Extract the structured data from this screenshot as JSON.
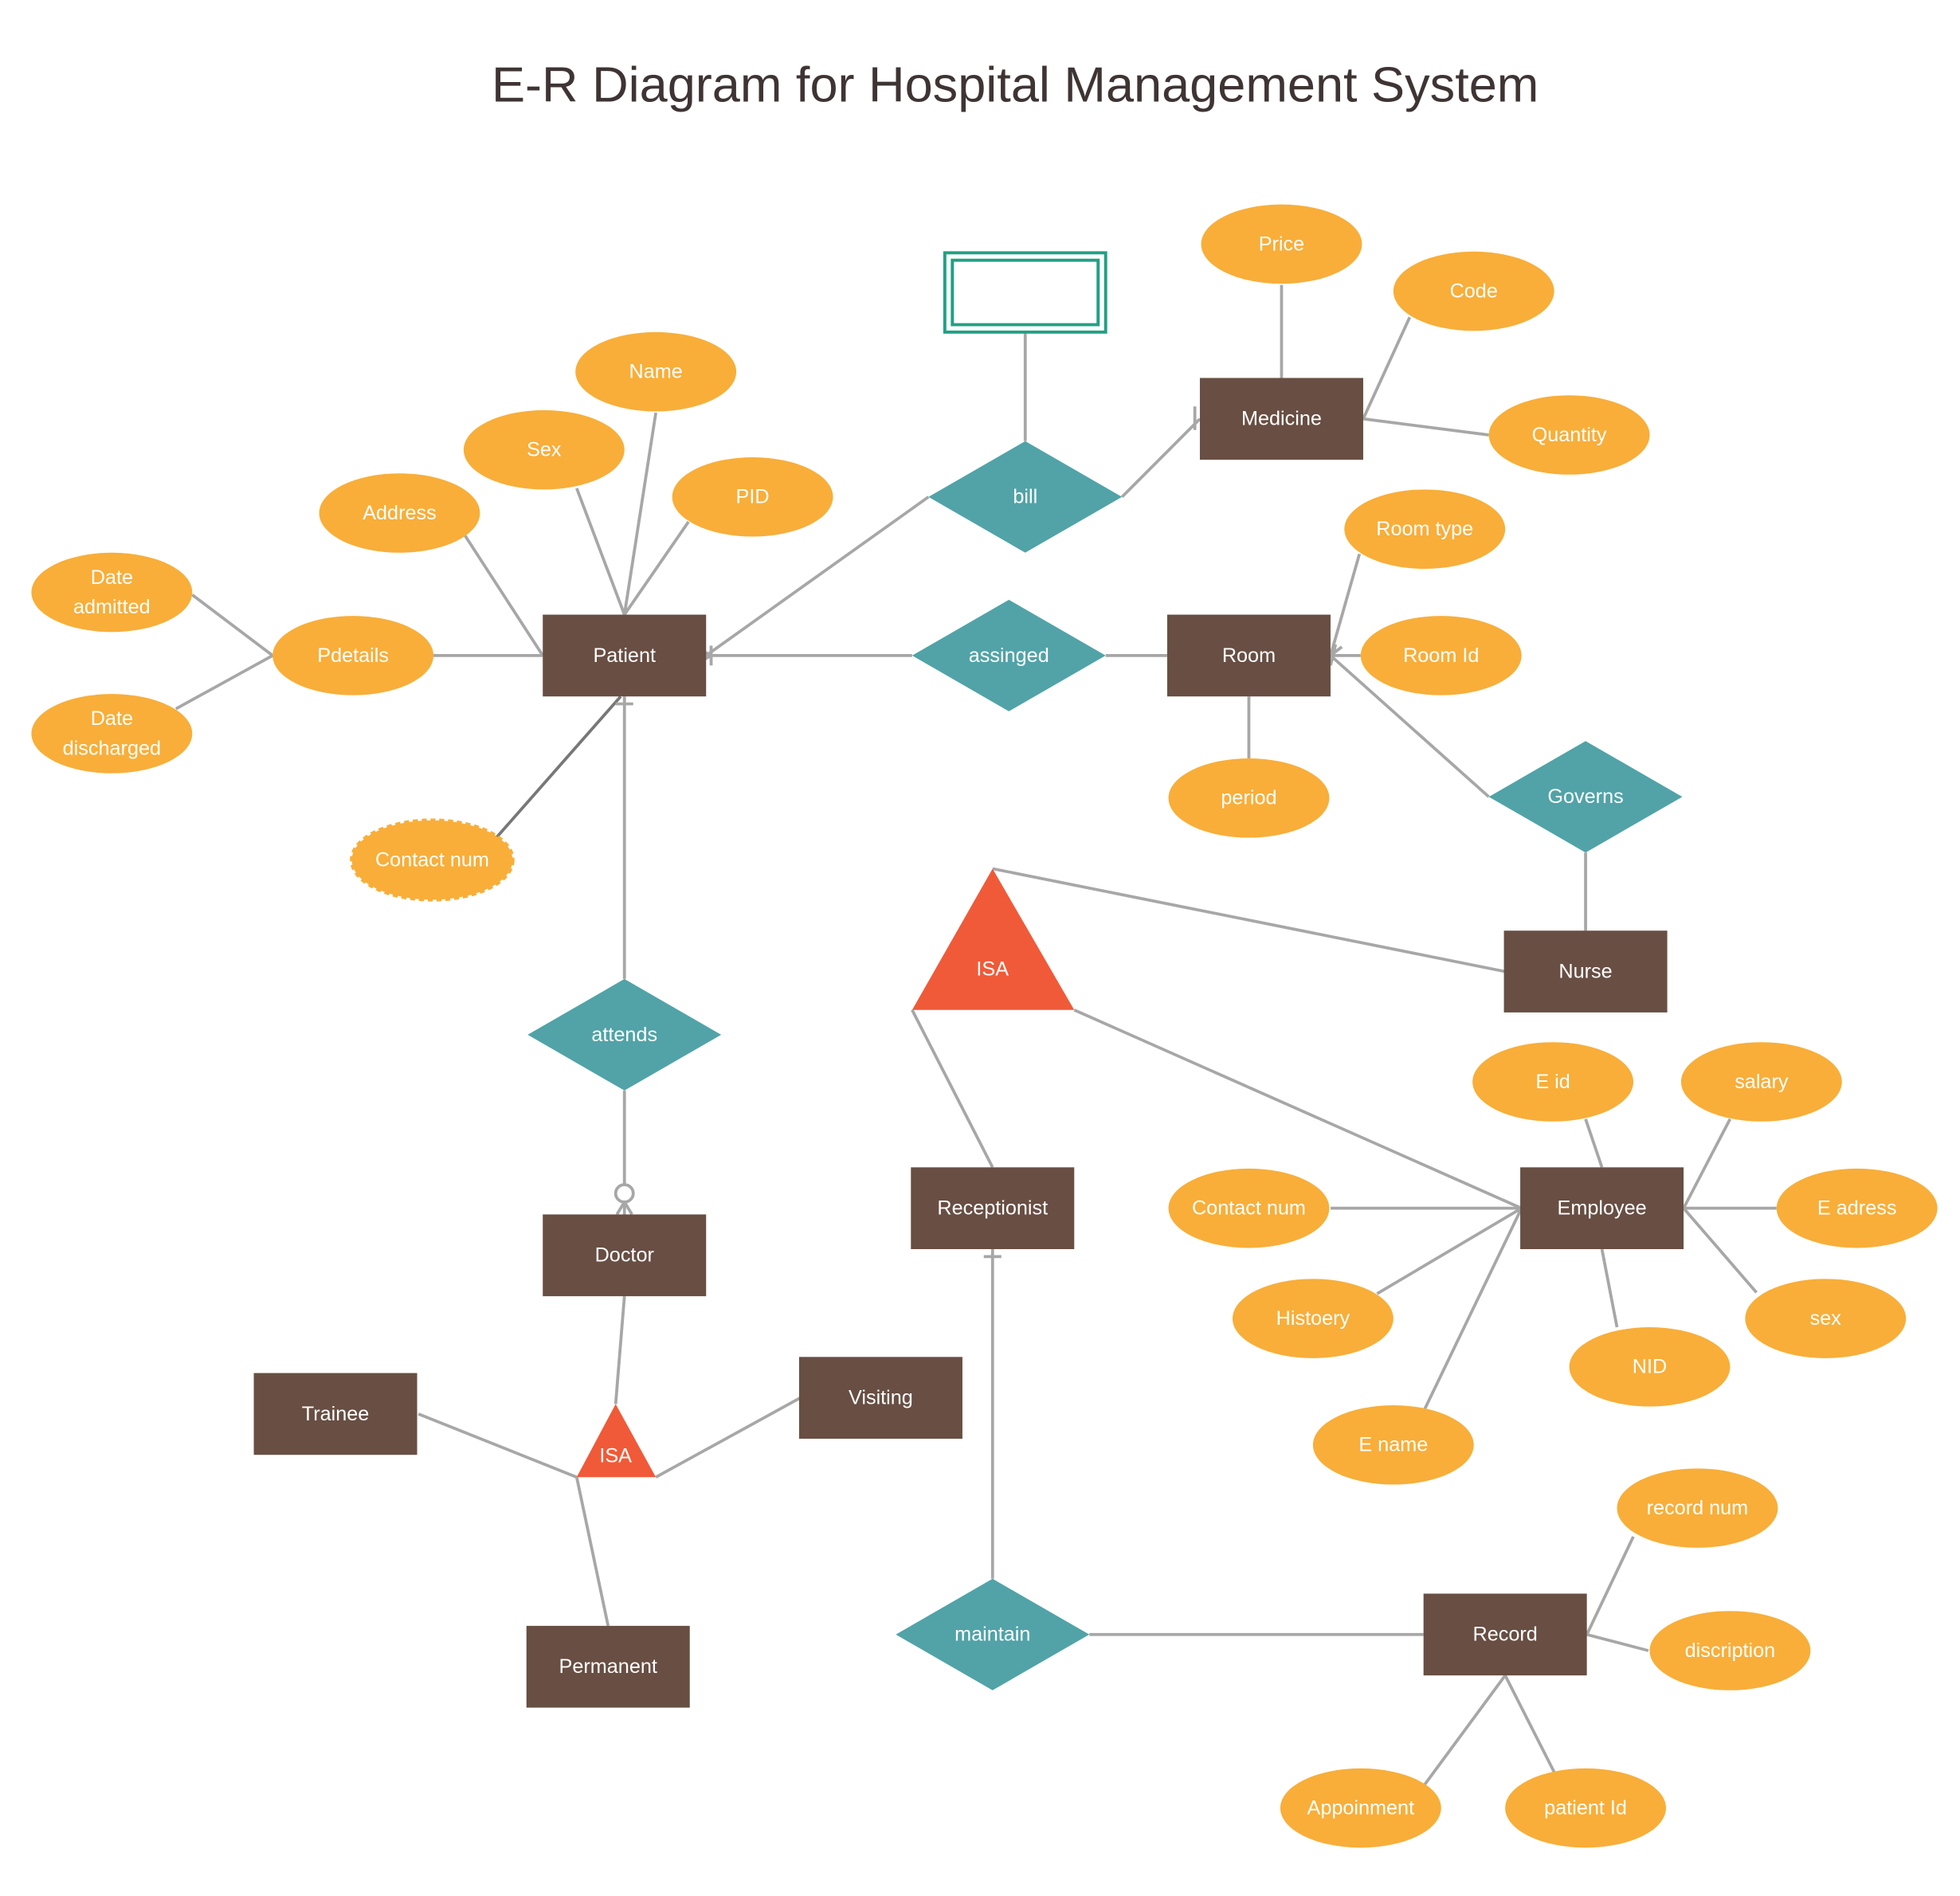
{
  "title": "E-R Diagram for Hospital Management System",
  "colors": {
    "entity": "#684e43",
    "attribute": "#f8ae39",
    "relationship": "#51a3a7",
    "isa": "#f05a38",
    "weak_entity_border": "#22a084",
    "connector": "#a7a7a7",
    "title": "#3f3434"
  },
  "entities": [
    {
      "id": "patient",
      "label": "Patient"
    },
    {
      "id": "medicine",
      "label": "Medicine"
    },
    {
      "id": "room",
      "label": "Room"
    },
    {
      "id": "nurse",
      "label": "Nurse"
    },
    {
      "id": "doctor",
      "label": "Doctor"
    },
    {
      "id": "receptionist",
      "label": "Receptionist"
    },
    {
      "id": "employee",
      "label": "Employee"
    },
    {
      "id": "trainee",
      "label": "Trainee"
    },
    {
      "id": "visiting",
      "label": "Visiting"
    },
    {
      "id": "permanent",
      "label": "Permanent"
    },
    {
      "id": "record",
      "label": "Record"
    },
    {
      "id": "weak_box",
      "label": ""
    }
  ],
  "relationships": [
    {
      "id": "bill",
      "label": "bill"
    },
    {
      "id": "assinged",
      "label": "assinged"
    },
    {
      "id": "governs",
      "label": "Governs"
    },
    {
      "id": "attends",
      "label": "attends"
    },
    {
      "id": "maintain",
      "label": "maintain"
    }
  ],
  "isa": [
    {
      "id": "isa_employee",
      "label": "ISA"
    },
    {
      "id": "isa_doctor",
      "label": "ISA"
    }
  ],
  "attributes": [
    {
      "id": "name",
      "label": "Name",
      "of": "patient"
    },
    {
      "id": "sex_p",
      "label": "Sex",
      "of": "patient"
    },
    {
      "id": "pid",
      "label": "PID",
      "of": "patient"
    },
    {
      "id": "address",
      "label": "Address",
      "of": "patient"
    },
    {
      "id": "pdetails",
      "label": "Pdetails",
      "of": "patient"
    },
    {
      "id": "date_admitted",
      "label": "Date admitted",
      "lines": [
        "Date",
        "admitted"
      ],
      "of": "pdetails"
    },
    {
      "id": "date_discharged",
      "label": "Date discharged",
      "lines": [
        "Date",
        "discharged"
      ],
      "of": "pdetails"
    },
    {
      "id": "contact_p",
      "label": "Contact num",
      "of": "patient",
      "derived": true
    },
    {
      "id": "price",
      "label": "Price",
      "of": "medicine"
    },
    {
      "id": "code",
      "label": "Code",
      "of": "medicine"
    },
    {
      "id": "quantity",
      "label": "Quantity",
      "of": "medicine"
    },
    {
      "id": "room_type",
      "label": "Room type",
      "of": "room"
    },
    {
      "id": "room_id",
      "label": "Room Id",
      "of": "room"
    },
    {
      "id": "period",
      "label": "period",
      "of": "room"
    },
    {
      "id": "eid",
      "label": "E id",
      "of": "employee"
    },
    {
      "id": "salary",
      "label": "salary",
      "of": "employee"
    },
    {
      "id": "eadress",
      "label": "E adress",
      "of": "employee"
    },
    {
      "id": "sex_e",
      "label": "sex",
      "of": "employee"
    },
    {
      "id": "nid",
      "label": "NID",
      "of": "employee"
    },
    {
      "id": "ename",
      "label": "E name",
      "of": "employee"
    },
    {
      "id": "histoery",
      "label": "Histoery",
      "of": "employee"
    },
    {
      "id": "contact_e",
      "label": "Contact num",
      "of": "employee"
    },
    {
      "id": "record_num",
      "label": "record num",
      "of": "record"
    },
    {
      "id": "discription",
      "label": "discription",
      "of": "record"
    },
    {
      "id": "appoinment",
      "label": "Appoinment",
      "of": "record"
    },
    {
      "id": "patient_id",
      "label": "patient Id",
      "of": "record"
    }
  ]
}
